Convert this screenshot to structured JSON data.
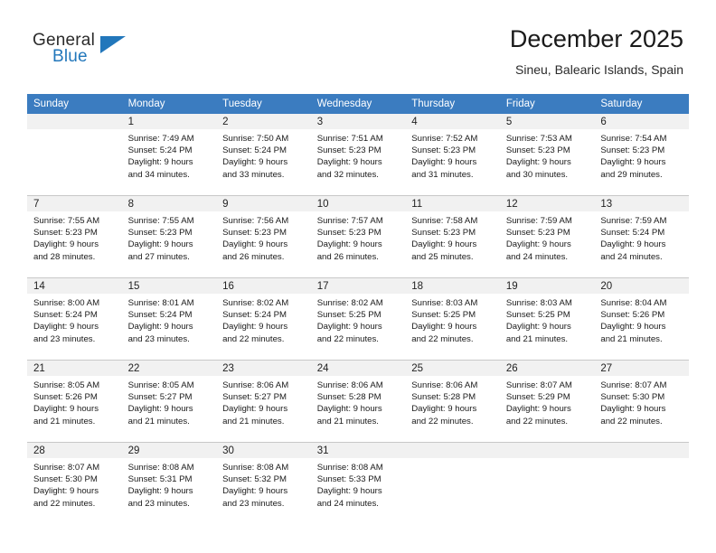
{
  "brand": {
    "name_top": "General",
    "name_bottom": "Blue",
    "accent_color": "#2277bb"
  },
  "header": {
    "title": "December 2025",
    "subtitle": "Sineu, Balearic Islands, Spain",
    "header_bg_color": "#3b7cc0"
  },
  "weekdays": [
    "Sunday",
    "Monday",
    "Tuesday",
    "Wednesday",
    "Thursday",
    "Friday",
    "Saturday"
  ],
  "weeks": [
    [
      {
        "day": "",
        "lines": []
      },
      {
        "day": "1",
        "lines": [
          "Sunrise: 7:49 AM",
          "Sunset: 5:24 PM",
          "Daylight: 9 hours",
          "and 34 minutes."
        ]
      },
      {
        "day": "2",
        "lines": [
          "Sunrise: 7:50 AM",
          "Sunset: 5:24 PM",
          "Daylight: 9 hours",
          "and 33 minutes."
        ]
      },
      {
        "day": "3",
        "lines": [
          "Sunrise: 7:51 AM",
          "Sunset: 5:23 PM",
          "Daylight: 9 hours",
          "and 32 minutes."
        ]
      },
      {
        "day": "4",
        "lines": [
          "Sunrise: 7:52 AM",
          "Sunset: 5:23 PM",
          "Daylight: 9 hours",
          "and 31 minutes."
        ]
      },
      {
        "day": "5",
        "lines": [
          "Sunrise: 7:53 AM",
          "Sunset: 5:23 PM",
          "Daylight: 9 hours",
          "and 30 minutes."
        ]
      },
      {
        "day": "6",
        "lines": [
          "Sunrise: 7:54 AM",
          "Sunset: 5:23 PM",
          "Daylight: 9 hours",
          "and 29 minutes."
        ]
      }
    ],
    [
      {
        "day": "7",
        "lines": [
          "Sunrise: 7:55 AM",
          "Sunset: 5:23 PM",
          "Daylight: 9 hours",
          "and 28 minutes."
        ]
      },
      {
        "day": "8",
        "lines": [
          "Sunrise: 7:55 AM",
          "Sunset: 5:23 PM",
          "Daylight: 9 hours",
          "and 27 minutes."
        ]
      },
      {
        "day": "9",
        "lines": [
          "Sunrise: 7:56 AM",
          "Sunset: 5:23 PM",
          "Daylight: 9 hours",
          "and 26 minutes."
        ]
      },
      {
        "day": "10",
        "lines": [
          "Sunrise: 7:57 AM",
          "Sunset: 5:23 PM",
          "Daylight: 9 hours",
          "and 26 minutes."
        ]
      },
      {
        "day": "11",
        "lines": [
          "Sunrise: 7:58 AM",
          "Sunset: 5:23 PM",
          "Daylight: 9 hours",
          "and 25 minutes."
        ]
      },
      {
        "day": "12",
        "lines": [
          "Sunrise: 7:59 AM",
          "Sunset: 5:23 PM",
          "Daylight: 9 hours",
          "and 24 minutes."
        ]
      },
      {
        "day": "13",
        "lines": [
          "Sunrise: 7:59 AM",
          "Sunset: 5:24 PM",
          "Daylight: 9 hours",
          "and 24 minutes."
        ]
      }
    ],
    [
      {
        "day": "14",
        "lines": [
          "Sunrise: 8:00 AM",
          "Sunset: 5:24 PM",
          "Daylight: 9 hours",
          "and 23 minutes."
        ]
      },
      {
        "day": "15",
        "lines": [
          "Sunrise: 8:01 AM",
          "Sunset: 5:24 PM",
          "Daylight: 9 hours",
          "and 23 minutes."
        ]
      },
      {
        "day": "16",
        "lines": [
          "Sunrise: 8:02 AM",
          "Sunset: 5:24 PM",
          "Daylight: 9 hours",
          "and 22 minutes."
        ]
      },
      {
        "day": "17",
        "lines": [
          "Sunrise: 8:02 AM",
          "Sunset: 5:25 PM",
          "Daylight: 9 hours",
          "and 22 minutes."
        ]
      },
      {
        "day": "18",
        "lines": [
          "Sunrise: 8:03 AM",
          "Sunset: 5:25 PM",
          "Daylight: 9 hours",
          "and 22 minutes."
        ]
      },
      {
        "day": "19",
        "lines": [
          "Sunrise: 8:03 AM",
          "Sunset: 5:25 PM",
          "Daylight: 9 hours",
          "and 21 minutes."
        ]
      },
      {
        "day": "20",
        "lines": [
          "Sunrise: 8:04 AM",
          "Sunset: 5:26 PM",
          "Daylight: 9 hours",
          "and 21 minutes."
        ]
      }
    ],
    [
      {
        "day": "21",
        "lines": [
          "Sunrise: 8:05 AM",
          "Sunset: 5:26 PM",
          "Daylight: 9 hours",
          "and 21 minutes."
        ]
      },
      {
        "day": "22",
        "lines": [
          "Sunrise: 8:05 AM",
          "Sunset: 5:27 PM",
          "Daylight: 9 hours",
          "and 21 minutes."
        ]
      },
      {
        "day": "23",
        "lines": [
          "Sunrise: 8:06 AM",
          "Sunset: 5:27 PM",
          "Daylight: 9 hours",
          "and 21 minutes."
        ]
      },
      {
        "day": "24",
        "lines": [
          "Sunrise: 8:06 AM",
          "Sunset: 5:28 PM",
          "Daylight: 9 hours",
          "and 21 minutes."
        ]
      },
      {
        "day": "25",
        "lines": [
          "Sunrise: 8:06 AM",
          "Sunset: 5:28 PM",
          "Daylight: 9 hours",
          "and 22 minutes."
        ]
      },
      {
        "day": "26",
        "lines": [
          "Sunrise: 8:07 AM",
          "Sunset: 5:29 PM",
          "Daylight: 9 hours",
          "and 22 minutes."
        ]
      },
      {
        "day": "27",
        "lines": [
          "Sunrise: 8:07 AM",
          "Sunset: 5:30 PM",
          "Daylight: 9 hours",
          "and 22 minutes."
        ]
      }
    ],
    [
      {
        "day": "28",
        "lines": [
          "Sunrise: 8:07 AM",
          "Sunset: 5:30 PM",
          "Daylight: 9 hours",
          "and 22 minutes."
        ]
      },
      {
        "day": "29",
        "lines": [
          "Sunrise: 8:08 AM",
          "Sunset: 5:31 PM",
          "Daylight: 9 hours",
          "and 23 minutes."
        ]
      },
      {
        "day": "30",
        "lines": [
          "Sunrise: 8:08 AM",
          "Sunset: 5:32 PM",
          "Daylight: 9 hours",
          "and 23 minutes."
        ]
      },
      {
        "day": "31",
        "lines": [
          "Sunrise: 8:08 AM",
          "Sunset: 5:33 PM",
          "Daylight: 9 hours",
          "and 24 minutes."
        ]
      },
      {
        "day": "",
        "lines": []
      },
      {
        "day": "",
        "lines": []
      },
      {
        "day": "",
        "lines": []
      }
    ]
  ]
}
